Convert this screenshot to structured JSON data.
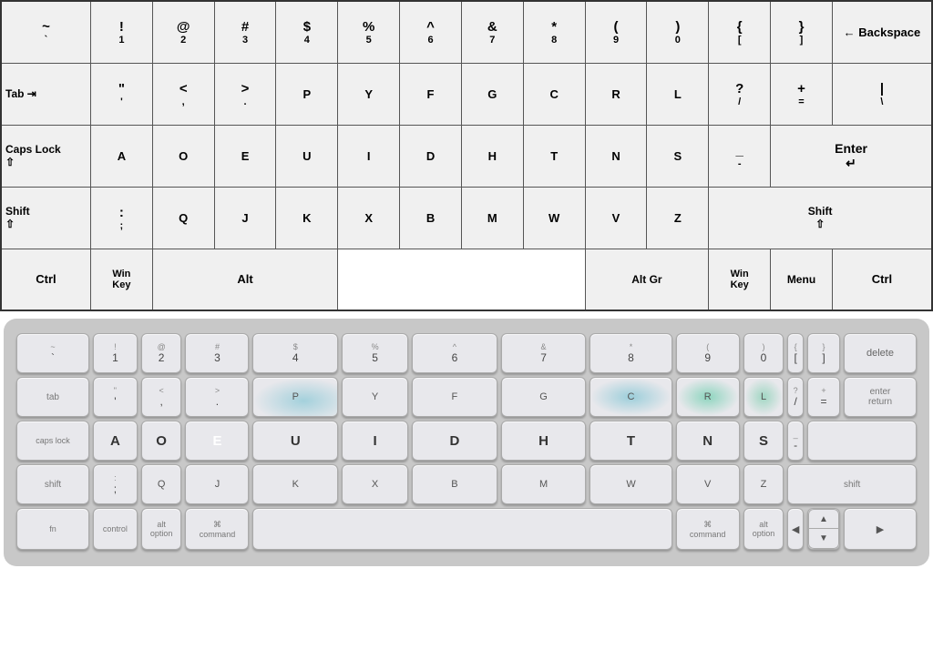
{
  "top_keyboard": {
    "rows": [
      {
        "keys": [
          {
            "label": "~",
            "sub": "`",
            "width": "normal"
          },
          {
            "label": "!",
            "sub": "1",
            "width": "normal"
          },
          {
            "label": "@",
            "sub": "2",
            "width": "normal"
          },
          {
            "label": "#",
            "sub": "3",
            "width": "normal"
          },
          {
            "label": "$",
            "sub": "4",
            "width": "normal"
          },
          {
            "label": "%",
            "sub": "5",
            "width": "normal"
          },
          {
            "label": "^",
            "sub": "6",
            "width": "normal"
          },
          {
            "label": "&",
            "sub": "7",
            "width": "normal"
          },
          {
            "label": "*",
            "sub": "8",
            "width": "normal"
          },
          {
            "label": "(",
            "sub": "9",
            "width": "normal"
          },
          {
            "label": ")",
            "sub": "0",
            "width": "normal"
          },
          {
            "label": "{",
            "sub": "[",
            "width": "normal"
          },
          {
            "label": "}",
            "sub": "]",
            "width": "normal"
          },
          {
            "label": "← Backspace",
            "sub": "",
            "width": "wide"
          }
        ]
      }
    ]
  },
  "bottom_keyboard": {
    "rows": [
      {
        "id": "num-row",
        "keys": [
          "~\n`",
          "!\n1",
          "@\n2",
          "#\n3",
          "$\n4",
          "%\n5",
          "^\n6",
          "&\n7",
          "*\n8",
          "(\n9",
          ")\n0",
          "{\n[",
          "}\n]",
          "delete"
        ]
      }
    ]
  }
}
